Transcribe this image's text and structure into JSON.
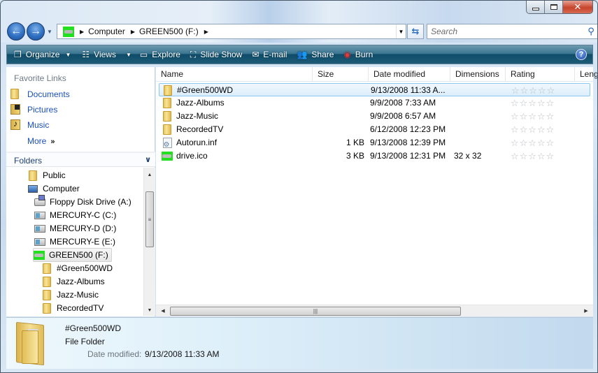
{
  "window": {
    "caption_buttons": {
      "minimize": "minimize",
      "maximize": "maximize",
      "close": "✕"
    }
  },
  "navigation": {
    "back_icon": "back-arrow-icon",
    "forward_icon": "forward-arrow-icon",
    "address": {
      "drive_icon": "green-drive-icon",
      "breadcrumbs": [
        "Computer",
        "GREEN500 (F:)"
      ]
    },
    "search": {
      "placeholder": "Search"
    }
  },
  "toolbar": {
    "items": [
      {
        "label": "Organize",
        "icon": "organize-icon",
        "has_dropdown": true
      },
      {
        "label": "Views",
        "icon": "views-icon",
        "has_dropdown": true
      },
      {
        "label": "Explore",
        "icon": "explore-icon"
      },
      {
        "label": "Slide Show",
        "icon": "slideshow-icon"
      },
      {
        "label": "E-mail",
        "icon": "email-icon"
      },
      {
        "label": "Share",
        "icon": "share-icon"
      },
      {
        "label": "Burn",
        "icon": "burn-icon"
      }
    ],
    "help": "?"
  },
  "sidebar": {
    "favorite_links_title": "Favorite Links",
    "favorites": [
      {
        "label": "Documents",
        "icon": "documents-folder-icon"
      },
      {
        "label": "Pictures",
        "icon": "pictures-folder-icon"
      },
      {
        "label": "Music",
        "icon": "music-folder-icon"
      }
    ],
    "more_label": "More",
    "more_glyph": "»",
    "folders_title": "Folders",
    "folders_chevron": "⌄",
    "tree": [
      {
        "label": "Public",
        "icon": "folder-icon",
        "level": 0
      },
      {
        "label": "Computer",
        "icon": "computer-icon",
        "level": 0
      },
      {
        "label": "Floppy Disk Drive (A:)",
        "icon": "floppy-drive-icon",
        "level": 1
      },
      {
        "label": "MERCURY-C (C:)",
        "icon": "network-drive-icon",
        "level": 1
      },
      {
        "label": "MERCURY-D (D:)",
        "icon": "network-drive-icon",
        "level": 1
      },
      {
        "label": "MERCURY-E (E:)",
        "icon": "network-drive-icon",
        "level": 1
      },
      {
        "label": "GREEN500 (F:)",
        "icon": "green-drive-icon",
        "level": 1,
        "selected": true
      },
      {
        "label": "#Green500WD",
        "icon": "folder-icon",
        "level": 2
      },
      {
        "label": "Jazz-Albums",
        "icon": "folder-icon",
        "level": 2
      },
      {
        "label": "Jazz-Music",
        "icon": "folder-icon",
        "level": 2
      },
      {
        "label": "RecordedTV",
        "icon": "folder-icon",
        "level": 2
      }
    ]
  },
  "file_list": {
    "columns": [
      "Name",
      "Size",
      "Date modified",
      "Dimensions",
      "Rating",
      "Length"
    ],
    "rows": [
      {
        "name": "#Green500WD",
        "icon": "folder-icon",
        "size": "",
        "date": "9/13/2008 11:33 A...",
        "dimensions": "",
        "rating": "☆☆☆☆☆",
        "selected": true
      },
      {
        "name": "Jazz-Albums",
        "icon": "folder-icon",
        "size": "",
        "date": "9/9/2008 7:33 AM",
        "dimensions": "",
        "rating": "☆☆☆☆☆"
      },
      {
        "name": "Jazz-Music",
        "icon": "folder-icon",
        "size": "",
        "date": "9/9/2008 6:57 AM",
        "dimensions": "",
        "rating": "☆☆☆☆☆"
      },
      {
        "name": "RecordedTV",
        "icon": "folder-icon",
        "size": "",
        "date": "6/12/2008 12:23 PM",
        "dimensions": "",
        "rating": "☆☆☆☆☆"
      },
      {
        "name": "Autorun.inf",
        "icon": "settings-file-icon",
        "size": "1 KB",
        "date": "9/13/2008 12:39 PM",
        "dimensions": "",
        "rating": "☆☆☆☆☆"
      },
      {
        "name": "drive.ico",
        "icon": "green-drive-icon",
        "size": "3 KB",
        "date": "9/13/2008 12:31 PM",
        "dimensions": "32 x 32",
        "rating": "☆☆☆☆☆"
      }
    ]
  },
  "details_pane": {
    "name": "#Green500WD",
    "type": "File Folder",
    "date_label": "Date modified:",
    "date_value": "9/13/2008 11:33 AM"
  }
}
